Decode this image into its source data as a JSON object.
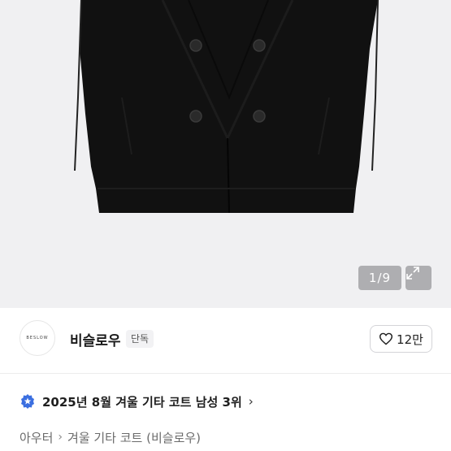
{
  "gallery": {
    "image_counter": "1/9",
    "current_index": 1,
    "total_images": 9
  },
  "seller": {
    "avatar_text": "BESLOW",
    "name": "비슬로우",
    "badge": "단독"
  },
  "like": {
    "count_label": "12만"
  },
  "ranking": {
    "text": "2025년 8월 겨울 기타 코트 남성 3위",
    "icon": "blue-star-badge-icon"
  },
  "category": {
    "level1": "아우터",
    "level2": "겨울 기타 코트 (비슬로우)"
  },
  "colors": {
    "gallery_bg": "#f0f0f2",
    "coat": "#111111",
    "badge_blue": "#3b6fe0"
  }
}
